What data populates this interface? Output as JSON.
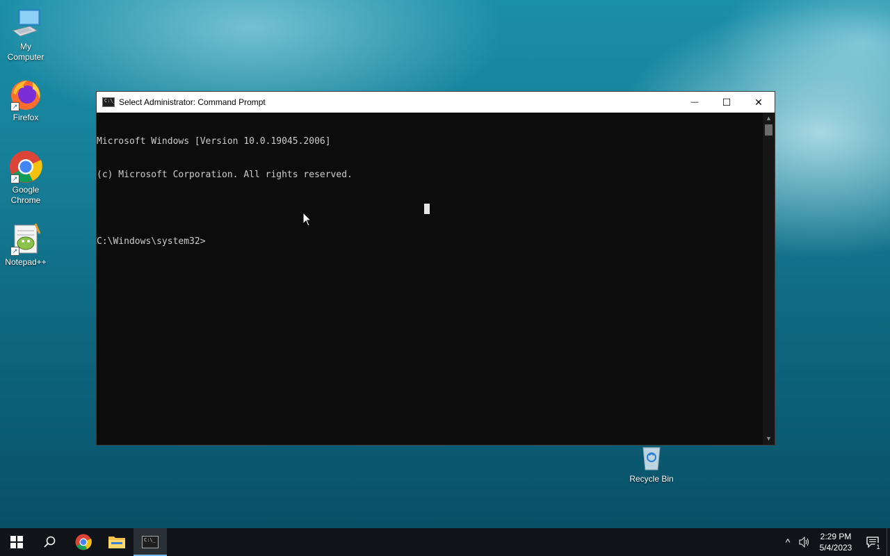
{
  "desktop": {
    "icons": [
      {
        "label_line1": "My",
        "label_line2": "Computer",
        "icon": "computer-icon"
      },
      {
        "label_line1": "Firefox",
        "label_line2": "",
        "icon": "firefox-icon"
      },
      {
        "label_line1": "Google",
        "label_line2": "Chrome",
        "icon": "chrome-icon"
      },
      {
        "label_line1": "Notepad++",
        "label_line2": "",
        "icon": "notepadpp-icon"
      }
    ],
    "recycle_bin": {
      "label": "Recycle Bin",
      "icon": "recycle-bin-icon"
    }
  },
  "window": {
    "title": "Select Administrator:  Command Prompt",
    "app_icon_text": "C:\\_",
    "minimize_glyph": "—",
    "maximize_glyph": "☐",
    "close_glyph": "✕",
    "console_lines": [
      "Microsoft Windows [Version 10.0.19045.2006]",
      "(c) Microsoft Corporation. All rights reserved.",
      "",
      "C:\\Windows\\system32>"
    ],
    "scroll_up_glyph": "▲",
    "scroll_down_glyph": "▼"
  },
  "taskbar": {
    "start_icon": "windows-start-icon",
    "search_icon": "search-icon",
    "pinned": [
      "chrome-icon",
      "file-explorer-icon",
      "command-prompt-icon"
    ],
    "tray": {
      "chevron_glyph": "^",
      "volume_glyph": "🔊",
      "time": "2:29 PM",
      "date": "5/4/2023",
      "notification_count": "1"
    }
  },
  "colors": {
    "console_bg": "#0c0c0c",
    "console_text": "#cccccc",
    "taskbar_bg": "#101418",
    "active_indicator": "#76b9ed"
  }
}
